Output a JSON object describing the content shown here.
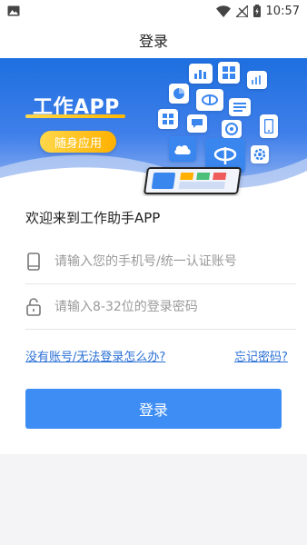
{
  "status_bar": {
    "time": "10:57",
    "icons": [
      "image-icon",
      "wifi-icon",
      "no-signal-icon",
      "battery-charging-icon"
    ]
  },
  "app_bar": {
    "title": "登录"
  },
  "banner": {
    "brand": "工作APP",
    "tagline": "随身应用",
    "colors": {
      "top": "#1e6fe0",
      "accent": "#ffc21a"
    }
  },
  "form": {
    "welcome": "欢迎来到工作助手APP",
    "phone_placeholder": "请输入您的手机号/统一认证账号",
    "password_placeholder": "请输入8-32位的登录密码",
    "no_account_link": "没有账号/无法登录怎么办?",
    "forgot_password_link": "忘记密码?",
    "login_button": "登录"
  },
  "colors": {
    "primary_button": "#3d8df5",
    "link": "#2a6fd6"
  }
}
